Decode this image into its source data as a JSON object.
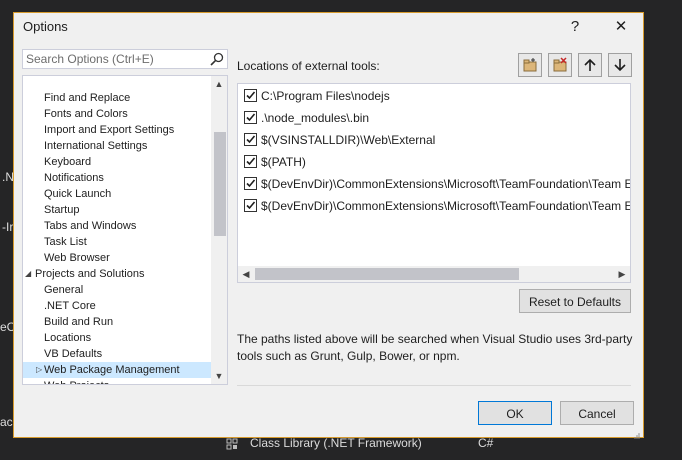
{
  "background": {
    "left_fragments": [
      ".N",
      "-Ir",
      "eC",
      "ack"
    ],
    "bottom_item": "Class Library (.NET Framework)",
    "bottom_lang": "C#"
  },
  "dialog": {
    "title": "Options",
    "help_label": "?",
    "close_label": "✕"
  },
  "search": {
    "placeholder": "Search Options (Ctrl+E)"
  },
  "tree": {
    "items": [
      {
        "label": "Find and Replace",
        "level": "child"
      },
      {
        "label": "Fonts and Colors",
        "level": "child"
      },
      {
        "label": "Import and Export Settings",
        "level": "child"
      },
      {
        "label": "International Settings",
        "level": "child"
      },
      {
        "label": "Keyboard",
        "level": "child"
      },
      {
        "label": "Notifications",
        "level": "child"
      },
      {
        "label": "Quick Launch",
        "level": "child"
      },
      {
        "label": "Startup",
        "level": "child"
      },
      {
        "label": "Tabs and Windows",
        "level": "child"
      },
      {
        "label": "Task List",
        "level": "child"
      },
      {
        "label": "Web Browser",
        "level": "child"
      },
      {
        "label": "Projects and Solutions",
        "level": "parent",
        "expanded": true
      },
      {
        "label": "General",
        "level": "child"
      },
      {
        "label": ".NET Core",
        "level": "child"
      },
      {
        "label": "Build and Run",
        "level": "child"
      },
      {
        "label": "Locations",
        "level": "child"
      },
      {
        "label": "VB Defaults",
        "level": "child"
      },
      {
        "label": "Web Package Management",
        "level": "child",
        "selected": true,
        "collapsible": true
      },
      {
        "label": "Web Projects",
        "level": "child"
      }
    ]
  },
  "panel": {
    "locations_label": "Locations of external tools:",
    "paths": [
      {
        "checked": true,
        "text": "C:\\Program Files\\nodejs"
      },
      {
        "checked": true,
        "text": ".\\node_modules\\.bin"
      },
      {
        "checked": true,
        "text": "$(VSINSTALLDIR)\\Web\\External"
      },
      {
        "checked": true,
        "text": "$(PATH)"
      },
      {
        "checked": true,
        "text": "$(DevEnvDir)\\CommonExtensions\\Microsoft\\TeamFoundation\\Team E"
      },
      {
        "checked": true,
        "text": "$(DevEnvDir)\\CommonExtensions\\Microsoft\\TeamFoundation\\Team E"
      }
    ],
    "reset_label": "Reset to Defaults",
    "description": "The paths listed above will be searched when Visual Studio uses 3rd-party tools such as Grunt, Gulp, Bower, or npm."
  },
  "footer": {
    "ok_label": "OK",
    "cancel_label": "Cancel"
  },
  "colors": {
    "accent_border": "#d79b2d",
    "selection": "#cce8ff",
    "ok_border": "#0078d7"
  }
}
